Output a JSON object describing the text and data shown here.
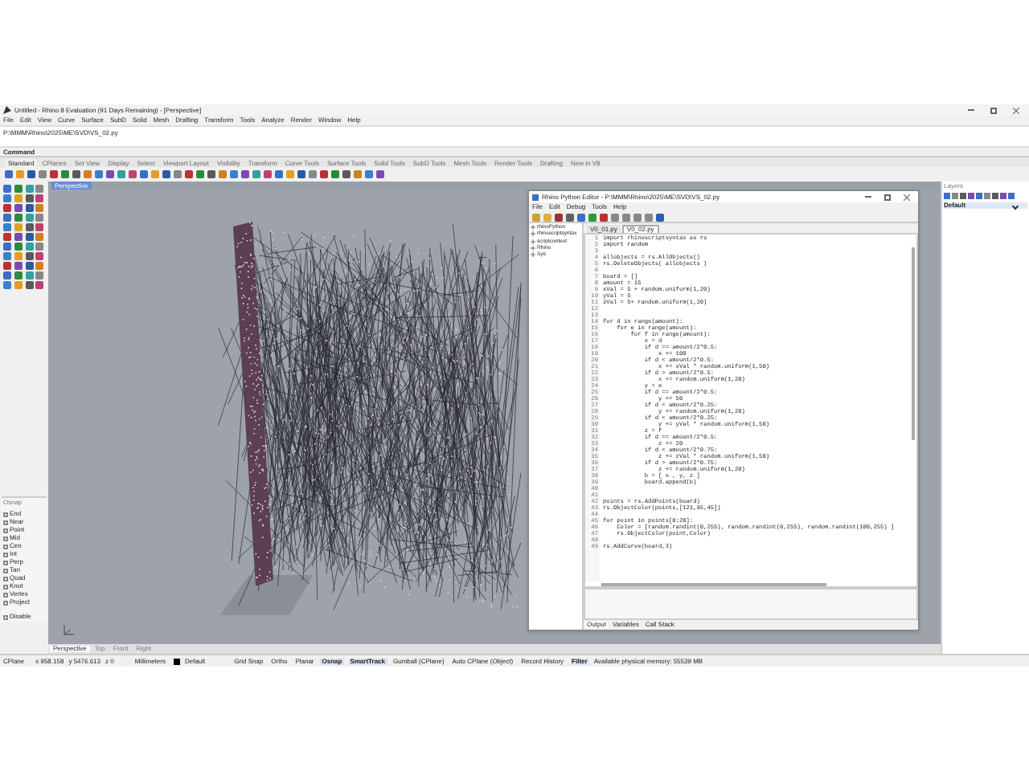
{
  "window": {
    "title": "Untitled - Rhino 8 Evaluation (91 Days Remaining) - [Perspective]"
  },
  "menu": [
    "File",
    "Edit",
    "View",
    "Curve",
    "Surface",
    "SubD",
    "Solid",
    "Mesh",
    "Drafting",
    "Transform",
    "Tools",
    "Analyze",
    "Render",
    "Window",
    "Help"
  ],
  "command_history": "P:\\MMM\\Rhino\\2025\\ME\\SVD\\VS_02.py",
  "command_prompt": "Command",
  "toolbar_tabs": [
    {
      "label": "Standard",
      "selected": true
    },
    {
      "label": "CPlanes",
      "selected": false
    },
    {
      "label": "Set View",
      "selected": false
    },
    {
      "label": "Display",
      "selected": false
    },
    {
      "label": "Select",
      "selected": false
    },
    {
      "label": "Viewport Layout",
      "selected": false
    },
    {
      "label": "Visibility",
      "selected": false
    },
    {
      "label": "Transform",
      "selected": false
    },
    {
      "label": "Curve Tools",
      "selected": false
    },
    {
      "label": "Surface Tools",
      "selected": false
    },
    {
      "label": "Solid Tools",
      "selected": false
    },
    {
      "label": "SubD Tools",
      "selected": false
    },
    {
      "label": "Mesh Tools",
      "selected": false
    },
    {
      "label": "Render Tools",
      "selected": false
    },
    {
      "label": "Drafting",
      "selected": false
    },
    {
      "label": "New in V8",
      "selected": false
    }
  ],
  "viewport": {
    "title": "Perspective",
    "tabs": [
      {
        "label": "Perspective",
        "selected": true
      },
      {
        "label": "Top",
        "selected": false
      },
      {
        "label": "Front",
        "selected": false
      },
      {
        "label": "Right",
        "selected": false
      }
    ]
  },
  "osnap": {
    "title": "Osnap",
    "items": [
      {
        "label": "End",
        "checked": false
      },
      {
        "label": "Near",
        "checked": false
      },
      {
        "label": "Point",
        "checked": false
      },
      {
        "label": "Mid",
        "checked": false
      },
      {
        "label": "Cen",
        "checked": false
      },
      {
        "label": "Int",
        "checked": false
      },
      {
        "label": "Perp",
        "checked": false
      },
      {
        "label": "Tan",
        "checked": false
      },
      {
        "label": "Quad",
        "checked": false
      },
      {
        "label": "Knot",
        "checked": false
      },
      {
        "label": "Vertex",
        "checked": false
      },
      {
        "label": "Project",
        "checked": false
      }
    ],
    "disable": {
      "label": "Disable",
      "checked": false
    }
  },
  "layers": {
    "title": "Layers",
    "items": [
      {
        "label": "Default",
        "checked": true
      }
    ]
  },
  "editor": {
    "title": "Rhino Python Editor - P:\\MMM\\Rhino\\2025\\ME\\SVD\\VS_02.py",
    "menu": [
      "File",
      "Edit",
      "Debug",
      "Tools",
      "Help"
    ],
    "tree": [
      "rhinoPython",
      "rhinoscriptsyntax",
      "scriptcontext",
      "Rhino",
      "Sys"
    ],
    "tabs": [
      {
        "label": "V0_01.py",
        "selected": false
      },
      {
        "label": "V0_02.py",
        "selected": true
      }
    ],
    "code": [
      {
        "number": "1",
        "text": "import rhinoscriptsyntax as rs"
      },
      {
        "number": "2",
        "text": "import random"
      },
      {
        "number": "3"
      },
      {
        "number": "4",
        "text": "allobjects = rs.AllObjects()"
      },
      {
        "number": "5",
        "text": "rs.DeleteObjects( allobjects )"
      },
      {
        "number": "6"
      },
      {
        "number": "7",
        "text": "board = []"
      },
      {
        "number": "8",
        "text": "amount = 15"
      },
      {
        "number": "9",
        "text": "xVal = 5 + random.uniform(1,20)"
      },
      {
        "number": "10",
        "text": "yVal = 5"
      },
      {
        "number": "11",
        "text": "zVal = 5+ random.uniform(1,20)"
      },
      {
        "number": "12"
      },
      {
        "number": "13"
      },
      {
        "number": "14",
        "text": "for d in range(amount):"
      },
      {
        "number": "15",
        "text": "    for e in range(amount):"
      },
      {
        "number": "16",
        "text": "        for f in range(amount):"
      },
      {
        "number": "17",
        "text": "            x = d"
      },
      {
        "number": "18",
        "text": "            if d == amount/2*0.5:"
      },
      {
        "number": "19",
        "text": "                x += 100"
      },
      {
        "number": "20",
        "text": "            if d < amount/2*0.5:"
      },
      {
        "number": "21",
        "text": "                x += xVal * random.uniform(1,50)"
      },
      {
        "number": "22",
        "text": "            if d > amount/2*0.5:"
      },
      {
        "number": "23",
        "text": "                x += random.uniform(1,20)"
      },
      {
        "number": "24",
        "text": "            y = e"
      },
      {
        "number": "25",
        "text": "            if d == amount/2*0.5:"
      },
      {
        "number": "26",
        "text": "                y += 50"
      },
      {
        "number": "27",
        "text": "            if d < amount/2*0.25:"
      },
      {
        "number": "28",
        "text": "                y += random.uniform(1,20)"
      },
      {
        "number": "29",
        "text": "            if d < amount/2*0.25:"
      },
      {
        "number": "30",
        "text": "                y += yVal * random.uniform(1,50)"
      },
      {
        "number": "31",
        "text": "            z = f"
      },
      {
        "number": "32",
        "text": "            if d == amount/2*0.5:"
      },
      {
        "number": "33",
        "text": "                z += 20"
      },
      {
        "number": "34",
        "text": "            if d < amount/2*0.75:"
      },
      {
        "number": "35",
        "text": "                z += zVal * random.uniform(1,50)"
      },
      {
        "number": "36",
        "text": "            if d > amount/2*0.75:"
      },
      {
        "number": "37",
        "text": "                z += random.uniform(1,20)"
      },
      {
        "number": "38",
        "text": "            b = [ x , y, z ]"
      },
      {
        "number": "39",
        "text": "            board.append(b)"
      },
      {
        "number": "40"
      },
      {
        "number": "41"
      },
      {
        "number": "42",
        "text": "points = rs.AddPoints(board)"
      },
      {
        "number": "43",
        "text": "rs.ObjectColor(points,[121,95,45])"
      },
      {
        "number": "44"
      },
      {
        "number": "45",
        "text": "for point in points[0:20]:"
      },
      {
        "number": "46",
        "text": "    Color = [random.randint(0,255), random.randint(0,255), random.randint(100,255) ]"
      },
      {
        "number": "47",
        "text": "    rs.ObjectColor(point,Color)"
      },
      {
        "number": "48"
      },
      {
        "number": "49",
        "text": "rs.AddCurve(board,3)"
      }
    ],
    "bottom_tabs": [
      {
        "label": "Output",
        "selected": true
      },
      {
        "label": "Variables",
        "selected": false
      },
      {
        "label": "Call Stack",
        "selected": false
      }
    ]
  },
  "status_bar": {
    "cplane": "CPlane",
    "x": "x 958.158",
    "y": "y 5476.613",
    "z": "z 0",
    "units": "Millimeters",
    "layer": "Default",
    "toggles": [
      {
        "label": "Grid Snap",
        "on": false
      },
      {
        "label": "Ortho",
        "on": false
      },
      {
        "label": "Planar",
        "on": false
      },
      {
        "label": "Osnap",
        "on": true
      },
      {
        "label": "SmartTrack",
        "on": true
      },
      {
        "label": "Gumball (CPlane)",
        "on": false
      },
      {
        "label": "Auto CPlane (Object)",
        "on": false
      },
      {
        "label": "Record History",
        "on": false
      },
      {
        "label": "Filter",
        "on": true
      }
    ],
    "memory": "Available physical memory: 55539 MB"
  }
}
